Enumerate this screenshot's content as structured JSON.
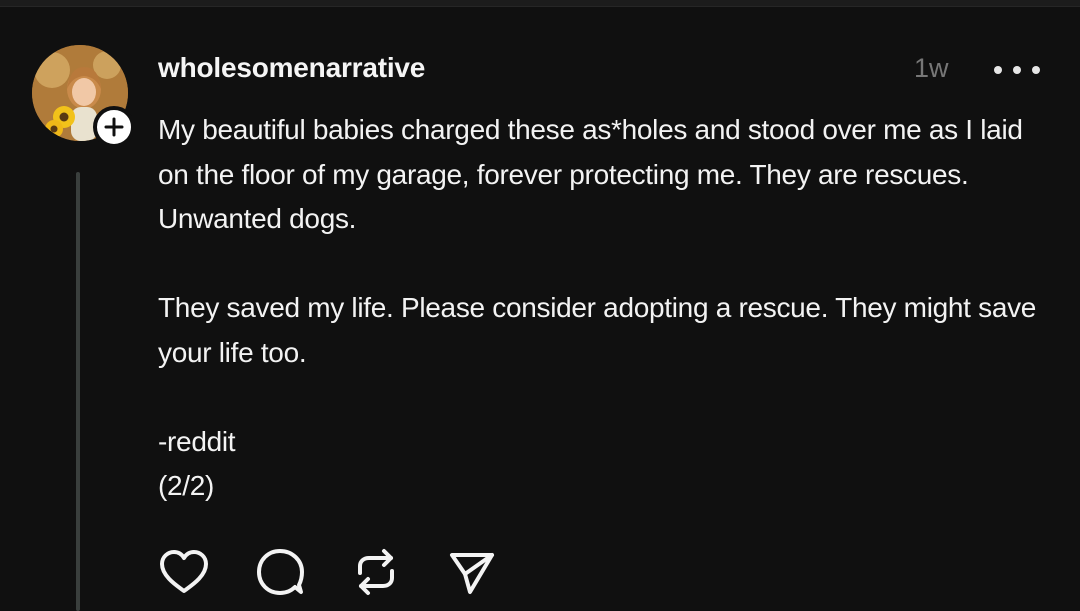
{
  "post": {
    "username": "wholesomenarrative",
    "timestamp": "1w",
    "paragraphs": [
      "My beautiful babies charged these as*holes and stood over me as I laid on the floor of my garage, forever protecting me. They are rescues. Unwanted dogs.",
      "They saved my life. Please consider adopting a rescue. They might save your life too.",
      "-reddit",
      "(2/2)"
    ]
  },
  "icons": {
    "more": "more-horizontal-icon",
    "follow": "plus-icon",
    "like": "heart-icon",
    "reply": "comment-icon",
    "repost": "repost-icon",
    "share": "send-icon"
  },
  "colors": {
    "background": "#101010",
    "text": "#f3f3f3",
    "muted": "#777777",
    "thread_line": "#3a3f3d"
  }
}
